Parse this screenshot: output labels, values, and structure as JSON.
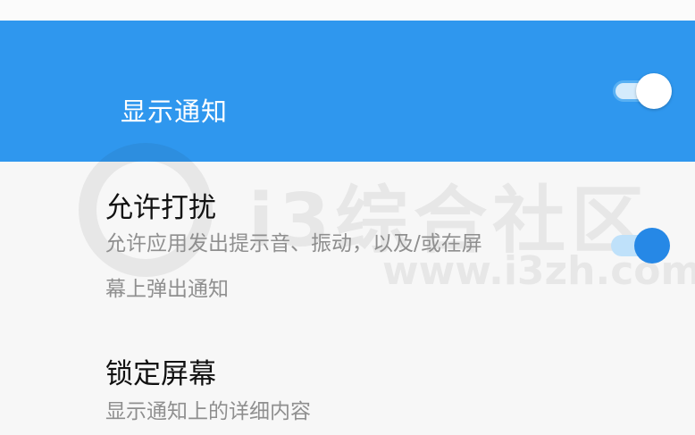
{
  "header": {
    "title": "显示通知",
    "toggle_on": true,
    "color": "#2f97ee"
  },
  "items": [
    {
      "title": "允许打扰",
      "description_line1": "允许应用发出提示音、振动，以及/或在屏",
      "description_line2": "幕上弹出通知",
      "toggle_on": true
    },
    {
      "title": "锁定屏幕",
      "description": "显示通知上的详细内容"
    }
  ],
  "watermark": {
    "text": "i3综合社区",
    "url": "www.i3zh.com"
  }
}
